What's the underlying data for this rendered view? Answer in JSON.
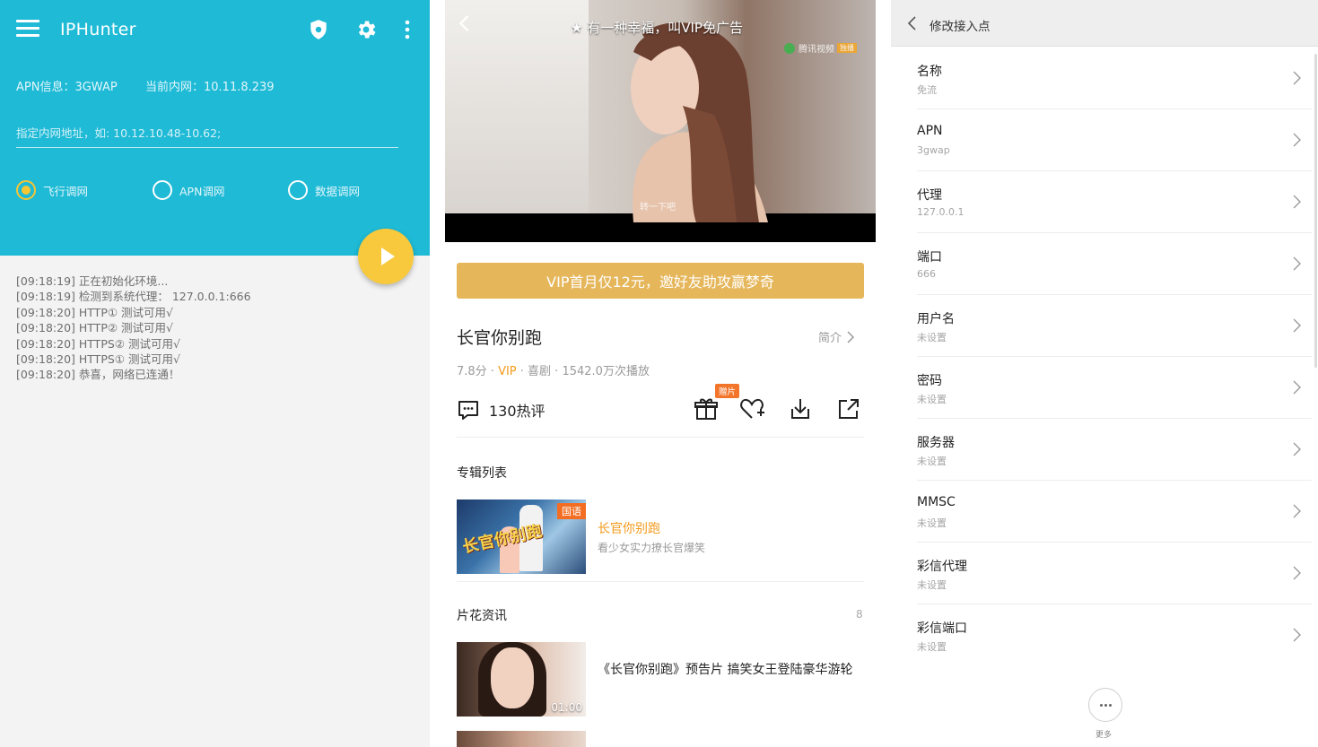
{
  "iphunter": {
    "app_title": "IPHunter",
    "apn_info": "APN信息：3GWAP",
    "current_ip": "当前内网：10.11.8.239",
    "ip_input_placeholder": "指定内网地址，如: 10.12.10.48-10.62;",
    "modes": [
      {
        "label": "飞行调网",
        "checked": true
      },
      {
        "label": "APN调网",
        "checked": false
      },
      {
        "label": "数据调网",
        "checked": false
      }
    ],
    "log": [
      "[09:18:19] 正在初始化环境...",
      "[09:18:19] 检测到系统代理： 127.0.0.1:666",
      "[09:18:20] HTTP① 测试可用√",
      "[09:18:20] HTTP② 测试可用√",
      "[09:18:20] HTTPS② 测试可用√",
      "[09:18:20] HTTPS① 测试可用√",
      "[09:18:20] 恭喜，网络已连通！"
    ],
    "colors": {
      "header": "#1ebad6",
      "fab": "#f8c93c",
      "radio_checked": "#f6c534"
    }
  },
  "video": {
    "top_ad": "有一种幸福，叫VIP免广告",
    "logo_text": "腾讯视频",
    "logo_badge": "独播",
    "subtitle_text": "转一下吧",
    "vip_banner": "VIP首月仅12元，邀好友助攻赢梦奇",
    "title": "长官你别跑",
    "intro_label": "简介",
    "meta_score": "7.8分 · ",
    "meta_vip": "VIP",
    "meta_rest": " · 喜剧 · 1542.0万次播放",
    "comments": "130热评",
    "gift_badge": "赠片",
    "section_album": "专辑列表",
    "album": {
      "tag": "国语",
      "calligraphy": "长官你别跑",
      "name": "长官你别跑",
      "desc": "看少女实力撩长官爆笑"
    },
    "section_clips": "片花资讯",
    "clips_count": "8",
    "clip": {
      "duration": "01:00",
      "title": "《长官你别跑》预告片 搞笑女王登陆豪华游轮"
    },
    "colors": {
      "vip_banner": "#e5b65a",
      "accent": "#f39a1c",
      "badge": "#f3752a"
    }
  },
  "apn": {
    "title": "修改接入点",
    "fields": [
      {
        "label": "名称",
        "value": "免流"
      },
      {
        "label": "APN",
        "value": "3gwap"
      },
      {
        "label": "代理",
        "value": "127.0.0.1"
      },
      {
        "label": "端口",
        "value": "666"
      },
      {
        "label": "用户名",
        "value": "未设置"
      },
      {
        "label": "密码",
        "value": "未设置"
      },
      {
        "label": "服务器",
        "value": "未设置"
      },
      {
        "label": "MMSC",
        "value": "未设置"
      },
      {
        "label": "彩信代理",
        "value": "未设置"
      },
      {
        "label": "彩信端口",
        "value": "未设置"
      }
    ],
    "more_label": "更多"
  }
}
